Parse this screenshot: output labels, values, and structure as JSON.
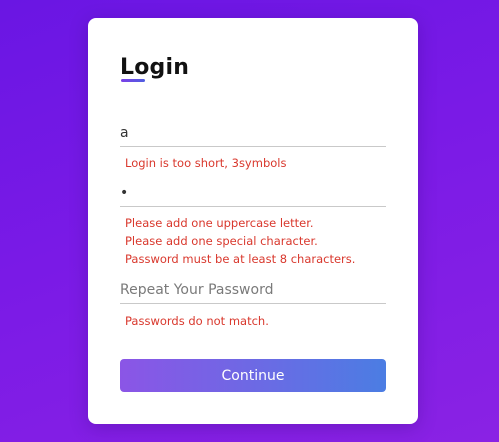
{
  "form": {
    "title": "Login",
    "login_field": {
      "value": "a",
      "placeholder": ""
    },
    "password_field": {
      "value": "•",
      "placeholder": ""
    },
    "repeat_password_field": {
      "value": "",
      "placeholder": "Repeat Your Password"
    },
    "errors": {
      "login": [
        "Login is too short, 3symbols"
      ],
      "password": [
        "Please add one uppercase letter.",
        "Please add one special character.",
        "Password must be at least 8 characters."
      ],
      "repeat_password": [
        "Passwords do not match."
      ]
    },
    "continue_label": "Continue"
  },
  "colors": {
    "background": "#7016e4",
    "accent": "#6a6be4",
    "error": "#d9382d"
  }
}
